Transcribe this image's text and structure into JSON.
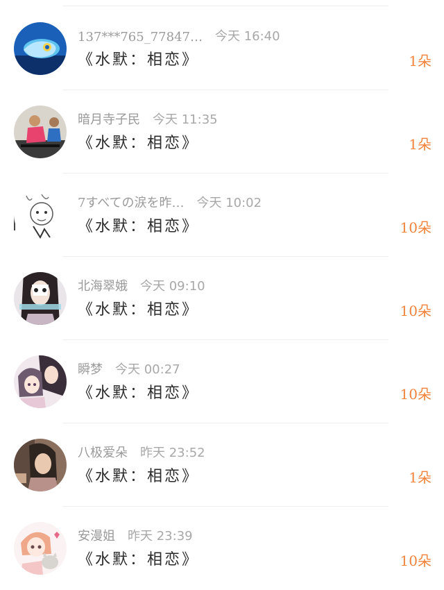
{
  "items": [
    {
      "name": "137***765_77847…",
      "time": "今天 16:40",
      "title": "《水默：相恋》",
      "count": "1朵",
      "avatar_icon": "blue-dragon-avatar"
    },
    {
      "name": "暗月寺子民",
      "time": "今天 11:35",
      "title": "《水默：相恋》",
      "count": "1朵",
      "avatar_icon": "gym-photo-avatar"
    },
    {
      "name": "7すべての涙を昨…",
      "time": "今天 10:02",
      "title": "《水默：相恋》",
      "count": "10朵",
      "avatar_icon": "sketch-avatar"
    },
    {
      "name": "北海翠娥",
      "time": "今天 09:10",
      "title": "《水默：相恋》",
      "count": "10朵",
      "avatar_icon": "girl-mask-avatar"
    },
    {
      "name": "瞬梦",
      "time": "今天 00:27",
      "title": "《水默：相恋》",
      "count": "10朵",
      "avatar_icon": "anime-couple-avatar"
    },
    {
      "name": "八极爱朵",
      "time": "昨天 23:52",
      "title": "《水默：相恋》",
      "count": "1朵",
      "avatar_icon": "vintage-photo-avatar"
    },
    {
      "name": "安漫姐",
      "time": "昨天 23:39",
      "title": "《水默：相恋》",
      "count": "10朵",
      "avatar_icon": "anime-girl-cat-avatar"
    }
  ],
  "colors": {
    "count": "#f0823a",
    "name": "#9a9a9a",
    "title": "#2b2b2b",
    "divider": "#eeeeee"
  }
}
